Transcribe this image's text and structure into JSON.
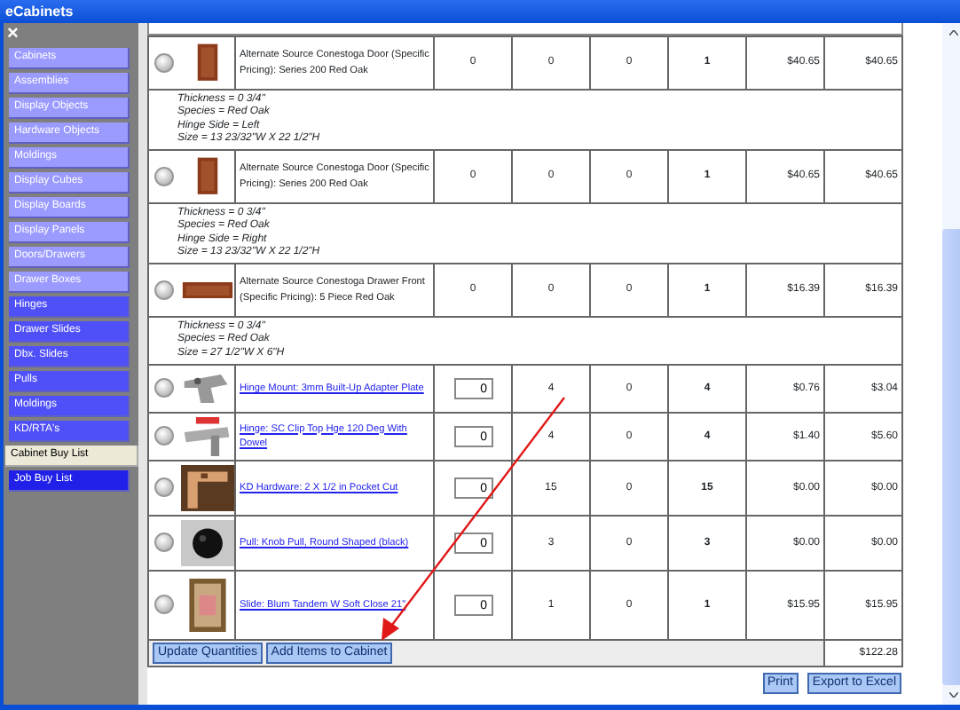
{
  "window": {
    "title": "eCabinets",
    "close": "×"
  },
  "sidebar": {
    "items": [
      {
        "label": "Cabinets",
        "kind": "catalog",
        "selected": false
      },
      {
        "label": "Assemblies",
        "kind": "catalog",
        "selected": false
      },
      {
        "label": "Display Objects",
        "kind": "catalog",
        "selected": false
      },
      {
        "label": "Hardware Objects",
        "kind": "catalog",
        "selected": false
      },
      {
        "label": "Moldings",
        "kind": "catalog",
        "selected": false
      },
      {
        "label": "Display Cubes",
        "kind": "catalog",
        "selected": false
      },
      {
        "label": "Display Boards",
        "kind": "catalog",
        "selected": false
      },
      {
        "label": "Display Panels",
        "kind": "catalog",
        "selected": false
      },
      {
        "label": "Doors/Drawers",
        "kind": "catalog",
        "selected": false
      },
      {
        "label": "Drawer Boxes",
        "kind": "catalog",
        "selected": false
      },
      {
        "label": "Hinges",
        "kind": "hardware",
        "selected": false
      },
      {
        "label": "Drawer Slides",
        "kind": "hardware",
        "selected": false
      },
      {
        "label": "Dbx. Slides",
        "kind": "hardware",
        "selected": false
      },
      {
        "label": "Pulls",
        "kind": "hardware",
        "selected": false
      },
      {
        "label": "Moldings",
        "kind": "hardware",
        "selected": false
      },
      {
        "label": "KD/RTA's",
        "kind": "hardware",
        "selected": false
      },
      {
        "label": "Cabinet Buy List",
        "kind": "list",
        "selected": true
      },
      {
        "label": "Job Buy List",
        "kind": "list",
        "selected": false
      }
    ]
  },
  "table": {
    "rows": [
      {
        "kind": "product",
        "description": "Alternate Source Conestoga Door (Specific Pricing): Series 200 Red Oak",
        "column_1": "0",
        "column_2": "0",
        "column_3": "0",
        "total": "1",
        "price": "$40.65",
        "extended": "$40.65",
        "details": [
          "Thickness = 0 3/4\"",
          "Species = Red Oak",
          "Hinge Side = Left",
          "Size = 13 23/32\"W X 22 1/2\"H"
        ]
      },
      {
        "kind": "product",
        "description": "Alternate Source Conestoga Door (Specific Pricing): Series 200 Red Oak",
        "column_1": "0",
        "column_2": "0",
        "column_3": "0",
        "total": "1",
        "price": "$40.65",
        "extended": "$40.65",
        "details": [
          "Thickness = 0 3/4\"",
          "Species = Red Oak",
          "Hinge Side = Right",
          "Size = 13 23/32\"W X 22 1/2\"H"
        ]
      },
      {
        "kind": "product",
        "description": "Alternate Source Conestoga Drawer Front (Specific Pricing): 5 Piece Red Oak",
        "column_1": "0",
        "column_2": "0",
        "column_3": "0",
        "total": "1",
        "price": "$16.39",
        "extended": "$16.39",
        "details": [
          "Thickness = 0 3/4\"",
          "Species = Red Oak",
          "Size = 27 1/2\"W X 6\"H"
        ]
      },
      {
        "kind": "hardware",
        "description": "Hinge Mount: 3mm Built-Up Adapter Plate",
        "column_1": "0",
        "column_2": "4",
        "column_3": "0",
        "total": "4",
        "price": "$0.76",
        "extended": "$3.04"
      },
      {
        "kind": "hardware",
        "description": "Hinge: SC Clip Top Hge 120 Deg With Dowel",
        "column_1": "0",
        "column_2": "4",
        "column_3": "0",
        "total": "4",
        "price": "$1.40",
        "extended": "$5.60"
      },
      {
        "kind": "hardware",
        "description": "KD Hardware: 2 X 1/2 in Pocket Cut",
        "column_1": "0",
        "column_2": "15",
        "column_3": "0",
        "total": "15",
        "price": "$0.00",
        "extended": "$0.00"
      },
      {
        "kind": "hardware",
        "description": "Pull: Knob Pull, Round Shaped (black)",
        "column_1": "0",
        "column_2": "3",
        "column_3": "0",
        "total": "3",
        "price": "$0.00",
        "extended": "$0.00"
      },
      {
        "kind": "hardware",
        "description": "Slide: Blum Tandem W Soft Close 21\"",
        "column_1": "0",
        "column_2": "1",
        "column_3": "0",
        "total": "1",
        "price": "$15.95",
        "extended": "$15.95"
      }
    ],
    "buttons": [
      "Update Quantities",
      "Add Items to Cabinet"
    ],
    "grand_total": "$122.28"
  },
  "footer_buttons": [
    "Print",
    "Export to Excel"
  ]
}
